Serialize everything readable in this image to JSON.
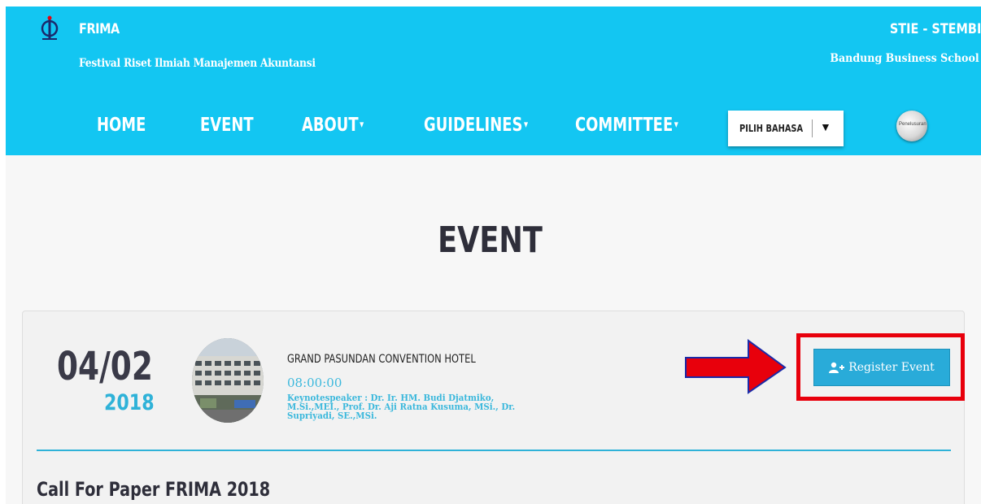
{
  "header": {
    "brand_title": "FRIMA",
    "brand_subtitle": "Festival Riset Ilmiah Manajemen Akuntansi",
    "school_title": "STIE - STEMBI",
    "school_subtitle": "Bandung Business School",
    "bg_color": "#13c6f2"
  },
  "nav": {
    "home": "HOME",
    "event": "EVENT",
    "about": "ABOUT",
    "guidelines": "GUIDELINES",
    "committee": "COMMITTEE",
    "language_label": "PILIH BAHASA",
    "language_arrow": "▼",
    "search_icon_text": "Penelusuran"
  },
  "main": {
    "page_title": "EVENT"
  },
  "event": {
    "day_month": "04/02",
    "year": "2018",
    "venue": "GRAND PASUNDAN CONVENTION HOTEL",
    "time": "08:00:00",
    "keynote": "Keynotespeaker : Dr. Ir. HM. Budi Djatmiko, M.Si.,MEI., Prof. Dr. Aji Ratna Kusuma, MSi., Dr. Supriyadi, SE.,MSi.",
    "register_label": "Register Event",
    "title": "Call For Paper FRIMA 2018"
  },
  "colors": {
    "accent": "#2fb2d8",
    "button": "#29abd9",
    "annotation_red": "#e8000c"
  }
}
